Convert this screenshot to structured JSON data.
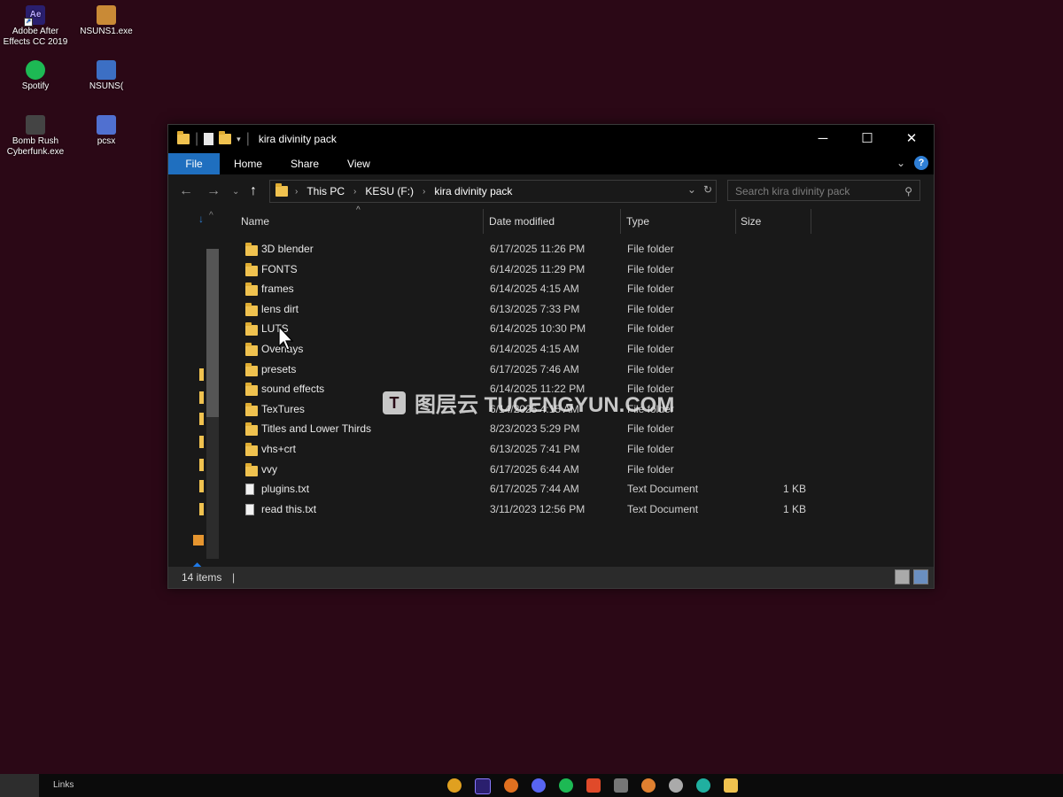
{
  "desktop": {
    "icons": [
      {
        "label_line1": "Adobe After",
        "label_line2": "Effects CC 2019",
        "icon": "after-effects-icon",
        "color": "#2a1f6e"
      },
      {
        "label_line1": "NSUNS1.exe",
        "label_line2": "",
        "icon": "game-icon",
        "color": "#c98a36"
      },
      {
        "label_line1": "Spotify",
        "label_line2": "",
        "icon": "spotify-icon",
        "color": "#1db954"
      },
      {
        "label_line1": "NSUNS(",
        "label_line2": "",
        "icon": "game-icon",
        "color": "#3c6fc4"
      },
      {
        "label_line1": "Bomb Rush",
        "label_line2": "Cyberfunk.exe",
        "icon": "game-icon",
        "color": "#444444"
      },
      {
        "label_line1": "pcsx",
        "label_line2": "",
        "icon": "emulator-icon",
        "color": "#5070d0"
      }
    ]
  },
  "window": {
    "title": "kira divinity pack",
    "ribbon_tabs": [
      "File",
      "Home",
      "Share",
      "View"
    ],
    "address": {
      "segments": [
        "This PC",
        "KESU (F:)",
        "kira divinity pack"
      ]
    },
    "search_placeholder": "Search kira divinity pack",
    "columns": {
      "name": "Name",
      "date": "Date modified",
      "type": "Type",
      "size": "Size"
    },
    "files": [
      {
        "name": "3D blender",
        "date": "6/17/2025 11:26 PM",
        "type": "File folder",
        "size": "",
        "kind": "folder"
      },
      {
        "name": "FONTS",
        "date": "6/14/2025 11:29 PM",
        "type": "File folder",
        "size": "",
        "kind": "folder"
      },
      {
        "name": "frames",
        "date": "6/14/2025 4:15 AM",
        "type": "File folder",
        "size": "",
        "kind": "folder"
      },
      {
        "name": "lens dirt",
        "date": "6/13/2025 7:33 PM",
        "type": "File folder",
        "size": "",
        "kind": "folder"
      },
      {
        "name": "LUTS",
        "date": "6/14/2025 10:30 PM",
        "type": "File folder",
        "size": "",
        "kind": "folder"
      },
      {
        "name": "Overlays",
        "date": "6/14/2025 4:15 AM",
        "type": "File folder",
        "size": "",
        "kind": "folder"
      },
      {
        "name": "presets",
        "date": "6/17/2025 7:46 AM",
        "type": "File folder",
        "size": "",
        "kind": "folder"
      },
      {
        "name": "sound effects",
        "date": "6/14/2025 11:22 PM",
        "type": "File folder",
        "size": "",
        "kind": "folder"
      },
      {
        "name": "TexTures",
        "date": "6/14/2025 4:15 AM",
        "type": "File folder",
        "size": "",
        "kind": "folder"
      },
      {
        "name": "Titles and Lower Thirds",
        "date": "8/23/2023 5:29 PM",
        "type": "File folder",
        "size": "",
        "kind": "folder"
      },
      {
        "name": "vhs+crt",
        "date": "6/13/2025 7:41 PM",
        "type": "File folder",
        "size": "",
        "kind": "folder"
      },
      {
        "name": "vvy",
        "date": "6/17/2025 6:44 AM",
        "type": "File folder",
        "size": "",
        "kind": "folder"
      },
      {
        "name": "plugins.txt",
        "date": "6/17/2025 7:44 AM",
        "type": "Text Document",
        "size": "1 KB",
        "kind": "text"
      },
      {
        "name": "read this.txt",
        "date": "3/11/2023 12:56 PM",
        "type": "Text Document",
        "size": "1 KB",
        "kind": "text"
      }
    ],
    "status": {
      "count": "14 items"
    }
  },
  "watermark": {
    "logo": "T",
    "text": "图层云  TUCENGYUN.COM"
  },
  "taskbar": {
    "links": "Links"
  },
  "colors": {
    "desktop": "#2b0816",
    "folder": "#f0c24f",
    "file_tab": "#1f6fbf"
  }
}
